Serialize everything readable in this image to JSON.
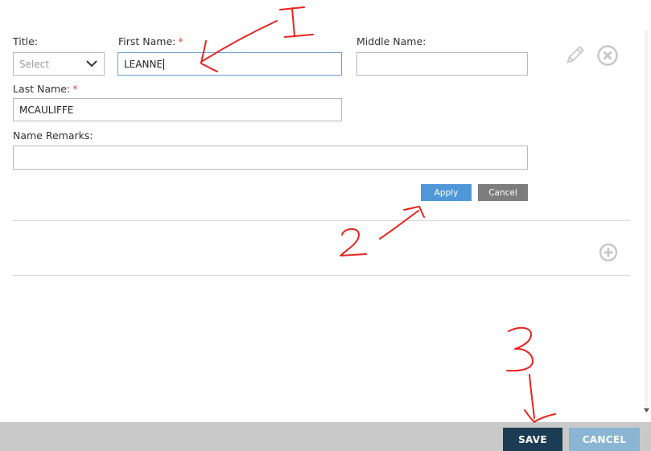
{
  "form": {
    "title_label": "Title:",
    "title_select_value": "Select",
    "first_name_label": "First Name:",
    "first_name_value": "LEANNE",
    "middle_name_label": "Middle Name:",
    "middle_name_value": "",
    "last_name_label": "Last Name:",
    "last_name_value": "MCAULIFFE",
    "name_remarks_label": "Name Remarks:",
    "name_remarks_value": "",
    "required_marker": "*",
    "apply_label": "Apply",
    "cancel_label": "Cancel"
  },
  "footer": {
    "save_label": "SAVE",
    "cancel_label": "CANCEL"
  },
  "annotations": {
    "one": "1",
    "two": "2",
    "three": "3",
    "color": "#e8231f"
  },
  "colors": {
    "apply": "#4f97d9",
    "cancel": "#7d7d7d",
    "save": "#1c3c55",
    "footer_cancel": "#8ab5d3",
    "footer_bar": "#c9c9c9"
  },
  "icons": {
    "edit": "pencil-icon",
    "remove": "close-circle-icon",
    "add": "plus-circle-icon",
    "dropdown": "chevron-down-icon"
  }
}
